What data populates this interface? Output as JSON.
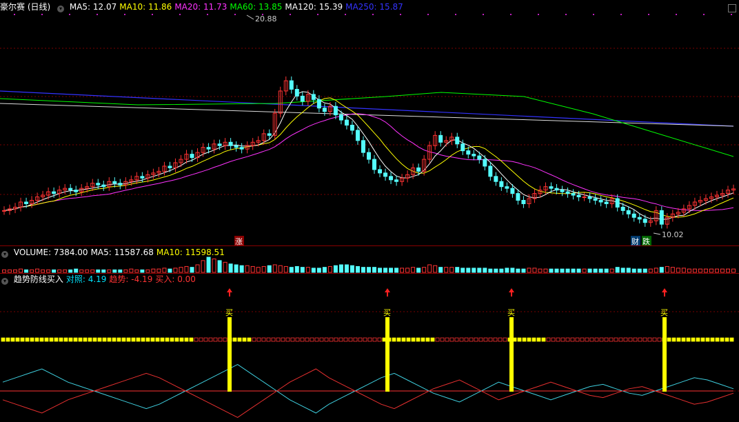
{
  "title": "豪尔赛 (日线)",
  "ma_labels": [
    {
      "text": "MA5: 12.07",
      "color": "#ffffff"
    },
    {
      "text": "MA10: 11.86",
      "color": "#ffff00"
    },
    {
      "text": "MA20: 11.73",
      "color": "#ff33ff"
    },
    {
      "text": "MA60: 13.85",
      "color": "#00ff00"
    },
    {
      "text": "MA120: 15.39",
      "color": "#ffffff"
    },
    {
      "text": "MA250: 15.87",
      "color": "#3333ff"
    }
  ],
  "price_high_label": "20.88",
  "price_low_label": "10.02",
  "tags": {
    "zhang": "涨",
    "cai": "财",
    "die": "跌"
  },
  "volume_labels": [
    {
      "text": "VOLUME: 7384.00",
      "color": "#ffffff"
    },
    {
      "text": "MA5: 11587.68",
      "color": "#ffffff"
    },
    {
      "text": "MA10: 11598.51",
      "color": "#ffff00"
    }
  ],
  "indicator_labels": [
    {
      "text": "趋势防线买入",
      "color": "#ffffff"
    },
    {
      "text": "对照: 4.19",
      "color": "#00e5ff"
    },
    {
      "text": "趋势: -4.19",
      "color": "#ff3333"
    },
    {
      "text": "买入: 0.00",
      "color": "#ff3333"
    }
  ],
  "buy_label": "买",
  "colors": {
    "up": "#ff3333",
    "down": "#54fcfc",
    "ma5": "#ffffff",
    "ma10": "#ffff00",
    "ma20": "#ff33ff",
    "ma60": "#00ff00",
    "ma120": "#dddddd",
    "ma250": "#3333ff",
    "grid": "#7a0000",
    "yellow": "#ffff00"
  },
  "chart_data": {
    "type": "candlestick",
    "price_range": [
      9.2,
      22.4
    ],
    "closes": [
      10.8,
      10.9,
      11.0,
      11.3,
      11.2,
      11.4,
      11.6,
      11.7,
      11.9,
      11.8,
      12.0,
      12.1,
      12.0,
      11.9,
      12.1,
      12.2,
      12.4,
      12.3,
      12.2,
      12.5,
      12.4,
      12.3,
      12.5,
      12.6,
      12.8,
      12.7,
      12.9,
      13.0,
      13.1,
      13.4,
      13.3,
      13.6,
      13.8,
      14.1,
      13.9,
      14.2,
      14.5,
      14.4,
      14.7,
      14.6,
      14.8,
      14.6,
      14.5,
      14.4,
      14.6,
      14.8,
      14.9,
      15.3,
      15.2,
      16.5,
      17.8,
      18.4,
      17.9,
      17.5,
      17.2,
      17.6,
      17.3,
      16.8,
      16.6,
      16.9,
      16.4,
      16.1,
      15.8,
      15.5,
      14.9,
      14.2,
      13.8,
      13.2,
      13.0,
      12.8,
      12.6,
      12.5,
      12.7,
      12.9,
      13.3,
      13.1,
      13.8,
      14.6,
      15.2,
      14.8,
      14.9,
      15.1,
      14.7,
      14.3,
      14.1,
      14.0,
      13.8,
      13.4,
      12.8,
      12.5,
      12.2,
      12.1,
      11.8,
      11.4,
      11.2,
      11.5,
      11.8,
      12.0,
      12.2,
      12.1,
      12.0,
      11.9,
      11.8,
      11.7,
      11.6,
      11.6,
      11.5,
      11.4,
      11.3,
      11.2,
      11.5,
      11.0,
      10.8,
      10.6,
      10.4,
      10.3,
      10.1,
      10.2,
      10.8,
      10.0,
      10.4,
      10.6,
      10.7,
      10.9,
      11.1,
      11.3,
      11.4,
      11.5,
      11.6,
      11.7,
      11.8,
      12.0,
      12.07
    ],
    "ma250": [
      15.9,
      15.9,
      15.9,
      15.9,
      15.9,
      15.9,
      15.9,
      15.9,
      15.9,
      15.9
    ],
    "volume": [
      3,
      3,
      3,
      4,
      3,
      3,
      4,
      3,
      3,
      3,
      3,
      3,
      3,
      4,
      3,
      3,
      3,
      3,
      3,
      3,
      3,
      3,
      3,
      4,
      3,
      3,
      3,
      4,
      4,
      5,
      4,
      5,
      6,
      7,
      6,
      9,
      14,
      18,
      16,
      14,
      12,
      10,
      9,
      8,
      8,
      7,
      6,
      7,
      8,
      9,
      8,
      7,
      6,
      7,
      6,
      6,
      5,
      5,
      6,
      7,
      8,
      9,
      9,
      8,
      7,
      6,
      6,
      6,
      5,
      5,
      5,
      5,
      5,
      5,
      6,
      5,
      6,
      9,
      8,
      6,
      6,
      6,
      6,
      5,
      5,
      5,
      5,
      5,
      4,
      4,
      4,
      5,
      5,
      4,
      4,
      5,
      5,
      4,
      4,
      4,
      4,
      4,
      4,
      4,
      4,
      4,
      4,
      4,
      4,
      4,
      4,
      6,
      5,
      5,
      4,
      4,
      4,
      4,
      5,
      6,
      7,
      6,
      5,
      5,
      4,
      4,
      4,
      4,
      4,
      4,
      4,
      4,
      4
    ],
    "buy_signals_x_index": [
      51,
      86,
      114,
      148
    ],
    "compare_line": [
      4,
      6,
      8,
      10,
      7,
      4,
      2,
      0,
      -2,
      -4,
      -6,
      -8,
      -6,
      -3,
      0,
      3,
      6,
      9,
      12,
      8,
      4,
      0,
      -4,
      -7,
      -10,
      -6,
      -3,
      0,
      3,
      6,
      8,
      5,
      2,
      -1,
      -3,
      -5,
      -2,
      1,
      4,
      2,
      0,
      -2,
      -4,
      -2,
      0,
      2,
      3,
      1,
      -1,
      -2,
      0,
      2,
      4,
      6,
      5,
      3,
      1
    ],
    "trend_line": [
      -4,
      -6,
      -8,
      -10,
      -7,
      -4,
      -2,
      0,
      2,
      4,
      6,
      8,
      6,
      3,
      0,
      -3,
      -6,
      -9,
      -12,
      -8,
      -4,
      0,
      4,
      7,
      10,
      6,
      3,
      0,
      -3,
      -6,
      -8,
      -5,
      -2,
      1,
      3,
      5,
      2,
      -1,
      -4,
      -2,
      0,
      2,
      4,
      2,
      0,
      -2,
      -3,
      -1,
      1,
      2,
      0,
      -2,
      -4,
      -6,
      -5,
      -3,
      -1
    ]
  }
}
